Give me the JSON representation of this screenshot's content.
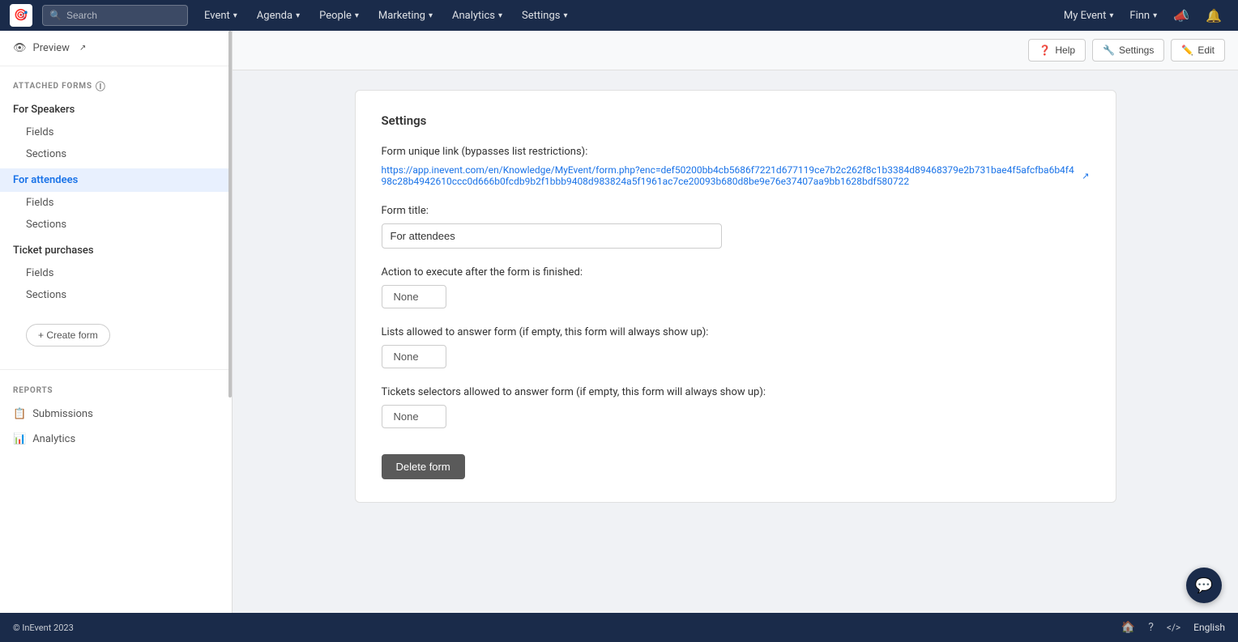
{
  "app": {
    "logo": "🎯",
    "copyright": "© InEvent 2023",
    "language": "English"
  },
  "topnav": {
    "search_placeholder": "Search",
    "items": [
      {
        "label": "Event",
        "has_dropdown": true
      },
      {
        "label": "Agenda",
        "has_dropdown": true
      },
      {
        "label": "People",
        "has_dropdown": true
      },
      {
        "label": "Marketing",
        "has_dropdown": true
      },
      {
        "label": "Analytics",
        "has_dropdown": true
      },
      {
        "label": "Settings",
        "has_dropdown": true
      }
    ],
    "right_items": [
      {
        "label": "My Event",
        "has_dropdown": true
      },
      {
        "label": "Finn",
        "has_dropdown": true
      }
    ]
  },
  "sidebar": {
    "preview_label": "Preview",
    "attached_forms_title": "ATTACHED FORMS",
    "groups": [
      {
        "label": "For Speakers",
        "items": [
          "Fields",
          "Sections"
        ]
      },
      {
        "label": "For attendees",
        "active": true,
        "items": [
          "Fields",
          "Sections"
        ]
      },
      {
        "label": "Ticket purchases",
        "items": [
          "Fields",
          "Sections"
        ]
      }
    ],
    "create_form_label": "+ Create form",
    "reports_title": "REPORTS",
    "reports_items": [
      {
        "label": "Submissions",
        "icon": "📋"
      },
      {
        "label": "Analytics",
        "icon": "📊"
      }
    ]
  },
  "toolbar": {
    "help_label": "Help",
    "settings_label": "Settings",
    "edit_label": "Edit"
  },
  "settings_card": {
    "title": "Settings",
    "form_link_label": "Form unique link (bypasses list restrictions):",
    "form_link_url": "https://app.inevent.com/en/Knowledge/MyEvent/form.php?enc=def50200bb4cb5686f7221d677119ce7b2c262f8c1b3384d89468379e2b731bae4f5afcfba6b4f498c28b4942610ccc0d666b0fcdb9b2f1bbb9408d983824a5f1961ac7ce20093b680d8be9e76e37407aa9bb1628bdf580722",
    "form_title_label": "Form title:",
    "form_title_value": "For attendees",
    "action_label": "Action to execute after the form is finished:",
    "action_value": "None",
    "lists_label": "Lists allowed to answer form (if empty, this form will always show up):",
    "lists_value": "None",
    "tickets_label": "Tickets selectors allowed to answer form (if empty, this form will always show up):",
    "tickets_value": "None",
    "delete_label": "Delete form"
  },
  "bottom_bar": {
    "home_icon": "🏠",
    "help_icon": "?",
    "code_icon": "</>",
    "language": "English"
  }
}
